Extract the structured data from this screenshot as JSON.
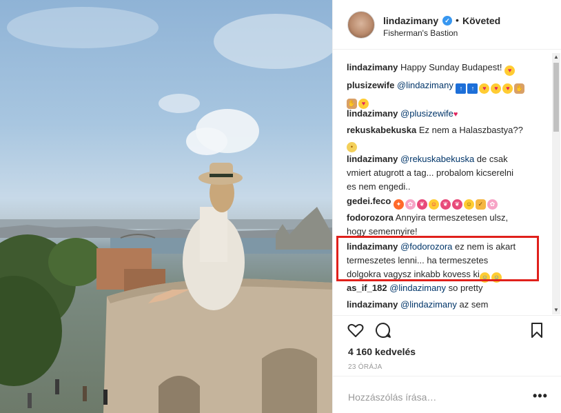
{
  "header": {
    "username": "lindazimany",
    "verified_mark": "✓",
    "separator": "•",
    "follow_label": "Követed",
    "location": "Fisherman's Bastion"
  },
  "comments": [
    {
      "user": "lindazimany",
      "parts": [
        {
          "t": "Happy Sunday Budapest! "
        }
      ],
      "emojis": [
        "heart-eyes"
      ]
    },
    {
      "user": "plusizewife",
      "mention": "@lindazimany"
    },
    {
      "user": "lindazimany",
      "mention": "@plusizewife"
    },
    {
      "user": "rekuskabekuska",
      "text": "Ez nem a Halaszbastya??"
    },
    {
      "user": "lindazimany",
      "mention": "@rekuskabekuska",
      "text": " de csak",
      "line2": "vmiert atugrott a tag... probalom kicserelni",
      "line3": "es nem engedi.."
    },
    {
      "user": "gedei.feco"
    },
    {
      "user": "fodorozora",
      "text": "Annyira termeszetesen ulsz,",
      "line2": "hogy semennyire!"
    },
    {
      "user": "lindazimany",
      "mention": "@fodorozora",
      "text": " ez nem is akart",
      "line2": "termeszetes lenni... ha termeszetes",
      "line3": "dolgokra vagysz inkabb kovess ki"
    },
    {
      "user": "as_if_182",
      "mention": "@lindazimany",
      "text": " so pretty"
    },
    {
      "user": "lindazimany",
      "mention": "@lindazimany",
      "text": " az sem"
    }
  ],
  "likes": "4 160 kedvelés",
  "time": "23 ÓRÁJA",
  "add_comment_placeholder": "Hozzászólás írása…",
  "more_label": "•••",
  "colors": {
    "accent": "#3897f0",
    "highlight_box": "#e0201b",
    "mention": "#003569"
  }
}
